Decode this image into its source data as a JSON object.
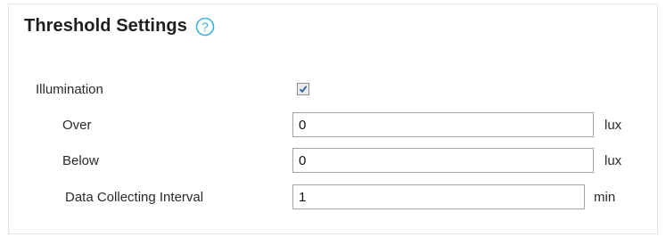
{
  "section": {
    "title": "Threshold Settings",
    "help_icon": "question-circle-icon",
    "accent_color": "#3ab3d8"
  },
  "illumination": {
    "label": "Illumination",
    "enabled": true
  },
  "fields": {
    "over": {
      "label": "Over",
      "value": "0",
      "unit": "lux"
    },
    "below": {
      "label": "Below",
      "value": "0",
      "unit": "lux"
    },
    "interval": {
      "label": "Data Collecting Interval",
      "value": "1",
      "unit": "min"
    }
  }
}
